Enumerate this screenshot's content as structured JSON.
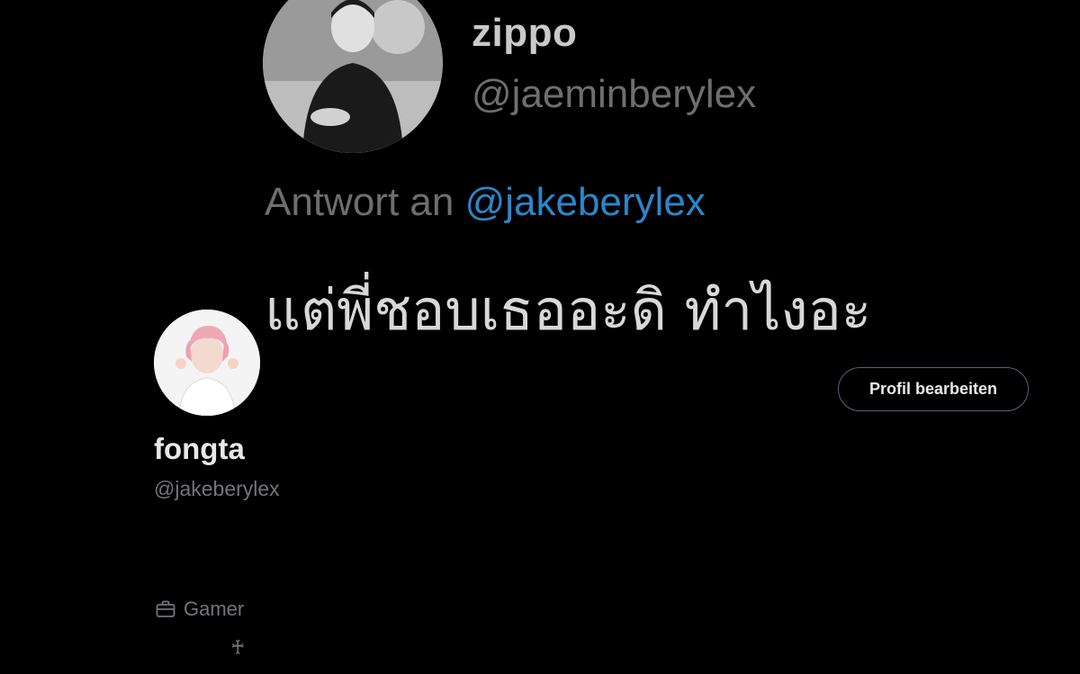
{
  "banner": {
    "tweet": {
      "author_name": "zippo",
      "author_handle": "@jaeminberylex",
      "reply_prefix": "Antwort an ",
      "reply_mention": "@jakeberylex",
      "text": "แต่พี่ชอบเธออะดิ ทำไงอะ"
    }
  },
  "profile": {
    "display_name": "fongta",
    "username": "@jakeberylex",
    "edit_button_label": "Profil bearbeiten",
    "category": "Gamer",
    "bio_symbol": "♰"
  },
  "colors": {
    "background": "#000000",
    "mention_blue": "#2c86c9",
    "muted_text": "#71767b"
  }
}
